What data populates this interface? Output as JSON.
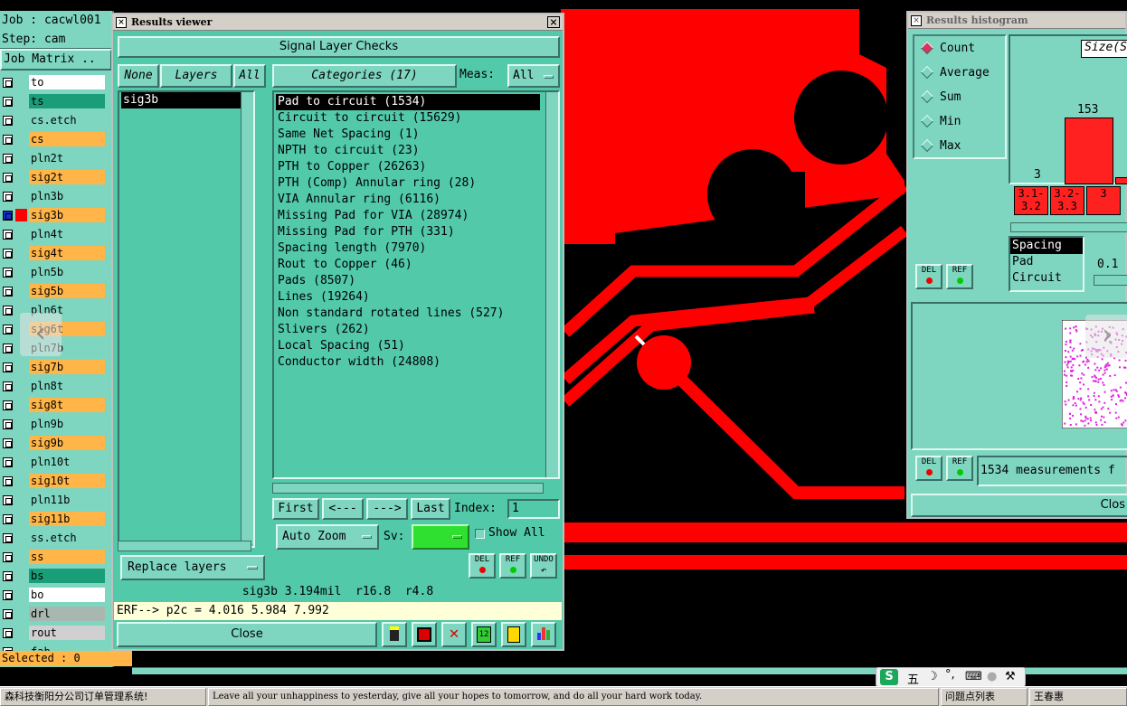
{
  "job_panel": {
    "job_line": "Job : cacwl001",
    "step_line": "Step: cam",
    "matrix_label": "Job Matrix ..",
    "selected_line": "Selected : 0",
    "layers": [
      {
        "name": "to",
        "color": "#ffffff",
        "text_color": "#000000",
        "sel": false
      },
      {
        "name": "ts",
        "color": "#1a9e78",
        "text_color": "#000000",
        "sel": false
      },
      {
        "name": "cs.etch",
        "color": "#7ed6c0",
        "text_color": "#000000",
        "sel": false
      },
      {
        "name": "cs",
        "color": "#ffb547",
        "text_color": "#000000",
        "sel": false
      },
      {
        "name": "pln2t",
        "color": "#7ed6c0",
        "text_color": "#000000",
        "sel": false
      },
      {
        "name": "sig2t",
        "color": "#ffb547",
        "text_color": "#000000",
        "sel": false
      },
      {
        "name": "pln3b",
        "color": "#7ed6c0",
        "text_color": "#000000",
        "sel": false
      },
      {
        "name": "sig3b",
        "color": "#ffb547",
        "text_color": "#000000",
        "sel": true
      },
      {
        "name": "pln4t",
        "color": "#7ed6c0",
        "text_color": "#000000",
        "sel": false
      },
      {
        "name": "sig4t",
        "color": "#ffb547",
        "text_color": "#000000",
        "sel": false
      },
      {
        "name": "pln5b",
        "color": "#7ed6c0",
        "text_color": "#000000",
        "sel": false
      },
      {
        "name": "sig5b",
        "color": "#ffb547",
        "text_color": "#000000",
        "sel": false
      },
      {
        "name": "pln6t",
        "color": "#7ed6c0",
        "text_color": "#000000",
        "sel": false
      },
      {
        "name": "sig6t",
        "color": "#ffb547",
        "text_color": "#000000",
        "sel": false
      },
      {
        "name": "pln7b",
        "color": "#7ed6c0",
        "text_color": "#000000",
        "sel": false
      },
      {
        "name": "sig7b",
        "color": "#ffb547",
        "text_color": "#000000",
        "sel": false
      },
      {
        "name": "pln8t",
        "color": "#7ed6c0",
        "text_color": "#000000",
        "sel": false
      },
      {
        "name": "sig8t",
        "color": "#ffb547",
        "text_color": "#000000",
        "sel": false
      },
      {
        "name": "pln9b",
        "color": "#7ed6c0",
        "text_color": "#000000",
        "sel": false
      },
      {
        "name": "sig9b",
        "color": "#ffb547",
        "text_color": "#000000",
        "sel": false
      },
      {
        "name": "pln10t",
        "color": "#7ed6c0",
        "text_color": "#000000",
        "sel": false
      },
      {
        "name": "sig10t",
        "color": "#ffb547",
        "text_color": "#000000",
        "sel": false
      },
      {
        "name": "pln11b",
        "color": "#7ed6c0",
        "text_color": "#000000",
        "sel": false
      },
      {
        "name": "sig11b",
        "color": "#ffb547",
        "text_color": "#000000",
        "sel": false
      },
      {
        "name": "ss.etch",
        "color": "#7ed6c0",
        "text_color": "#000000",
        "sel": false
      },
      {
        "name": "ss",
        "color": "#ffb547",
        "text_color": "#000000",
        "sel": false
      },
      {
        "name": "bs",
        "color": "#1a9e78",
        "text_color": "#000000",
        "sel": false
      },
      {
        "name": "bo",
        "color": "#ffffff",
        "text_color": "#000000",
        "sel": false
      },
      {
        "name": "drl",
        "color": "#a8b8b0",
        "text_color": "#000000",
        "sel": false
      },
      {
        "name": "rout",
        "color": "#d0d0d0",
        "text_color": "#000000",
        "sel": false
      },
      {
        "name": "fab",
        "color": "#7ed6c0",
        "text_color": "#000000",
        "sel": false
      }
    ]
  },
  "results_viewer": {
    "title": "Results viewer",
    "header": "Signal Layer Checks",
    "none_btn": "None",
    "layers_btn": "Layers",
    "all_btn": "All",
    "categories_btn": "Categories (17)",
    "meas_label": "Meas:",
    "meas_value": "All",
    "layer_list": [
      "sig3b"
    ],
    "categories": [
      "Pad to circuit (1534)",
      "Circuit to circuit (15629)",
      "Same Net Spacing (1)",
      "NPTH to circuit (23)",
      "PTH to Copper (26263)",
      "PTH (Comp) Annular ring (28)",
      "VIA Annular ring (6116)",
      "Missing Pad for VIA (28974)",
      "Missing Pad for PTH (331)",
      "Spacing length (7970)",
      "Rout to Copper (46)",
      "Pads (8507)",
      "Lines (19264)",
      "Non standard rotated lines (527)",
      "Slivers (262)",
      "Local Spacing (51)",
      "Conductor width (24808)"
    ],
    "selected_category": 0,
    "first_btn": "First",
    "prev_btn": "<---",
    "next_btn": "--->",
    "last_btn": "Last",
    "index_label": "Index:",
    "index_value": "1",
    "autozoom_btn": "Auto Zoom",
    "sv_label": "Sv:",
    "show_all_label": "Show All",
    "replace_btn": "Replace layers",
    "del_label": "DEL",
    "ref_label": "REF",
    "undo_label": "UNDO",
    "status_line": "sig3b 3.194mil  r16.8  r4.8",
    "erf_line": "ERF--> p2c = 4.016 5.984 7.992",
    "close_btn": "Close"
  },
  "histogram": {
    "title": "Results histogram",
    "radio_options": [
      "Count",
      "Average",
      "Sum",
      "Min",
      "Max"
    ],
    "radio_selected": 0,
    "size_label": "Size(S",
    "bar_values": {
      "first": "3",
      "second": "153"
    },
    "bin_labels": [
      "3.1-\n3.2",
      "3.2-\n3.3",
      "3"
    ],
    "list_items": [
      "Spacing",
      "Pad",
      "Circuit"
    ],
    "spin_value": "0.1",
    "del_label": "DEL",
    "ref_label": "REF",
    "measurements_text": "1534 measurements f",
    "close_btn": "Clos"
  },
  "taskbar": {
    "left_item": "森科技衡阳分公司订单管理系统!",
    "motto": "Leave all your unhappiness to yesterday, give all your hopes to tomorrow, and do all your hard work today.",
    "item2": "问题点列表",
    "item3": "王春惠",
    "ime_text": "五"
  },
  "colors": {
    "copper": "#ff0000",
    "background": "#000000",
    "panel": "#52c9a9",
    "panel_light": "#7ed6c0"
  }
}
